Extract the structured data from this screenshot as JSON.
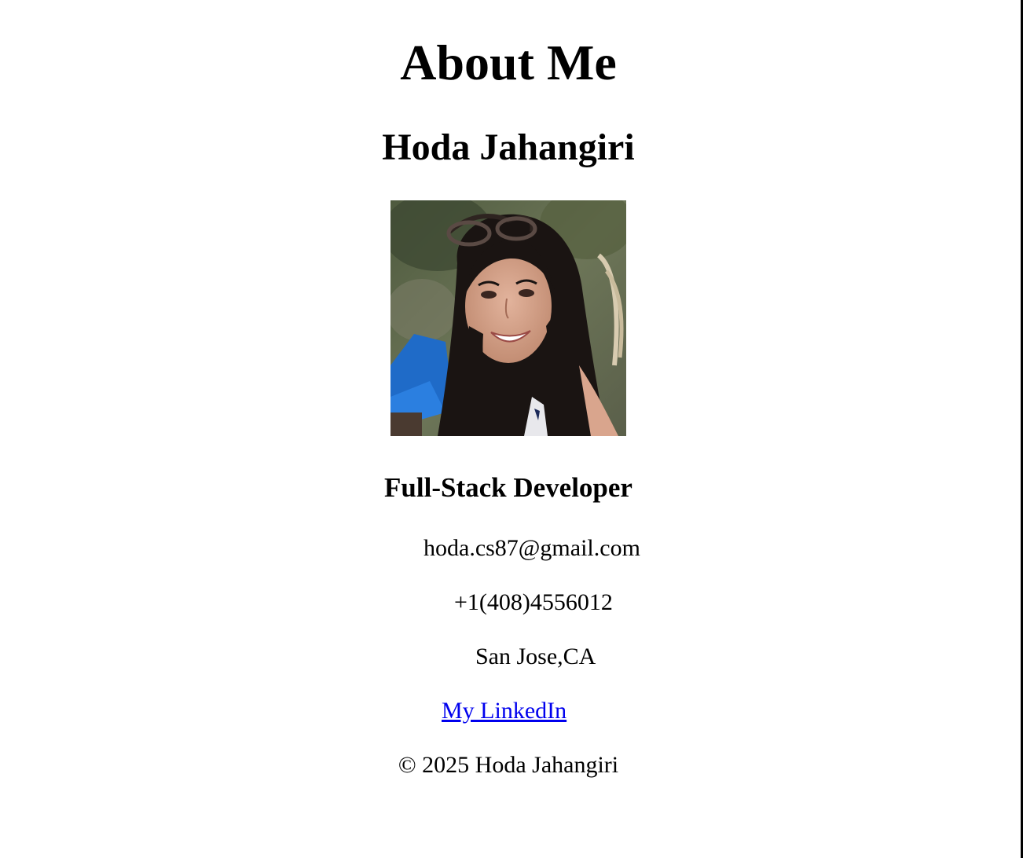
{
  "header": {
    "title": "About Me",
    "name": "Hoda Jahangiri"
  },
  "profile": {
    "photo_alt": "Hoda Jahangiri",
    "role": "Full-Stack Developer",
    "email": "hoda.cs87@gmail.com",
    "phone": "+1(408)4556012",
    "location": "San Jose,CA",
    "linkedin_label": "My LinkedIn"
  },
  "footer": {
    "copyright": "© 2025 Hoda Jahangiri"
  },
  "colors": {
    "link": "#0000ee",
    "text": "#000000",
    "background": "#ffffff"
  }
}
